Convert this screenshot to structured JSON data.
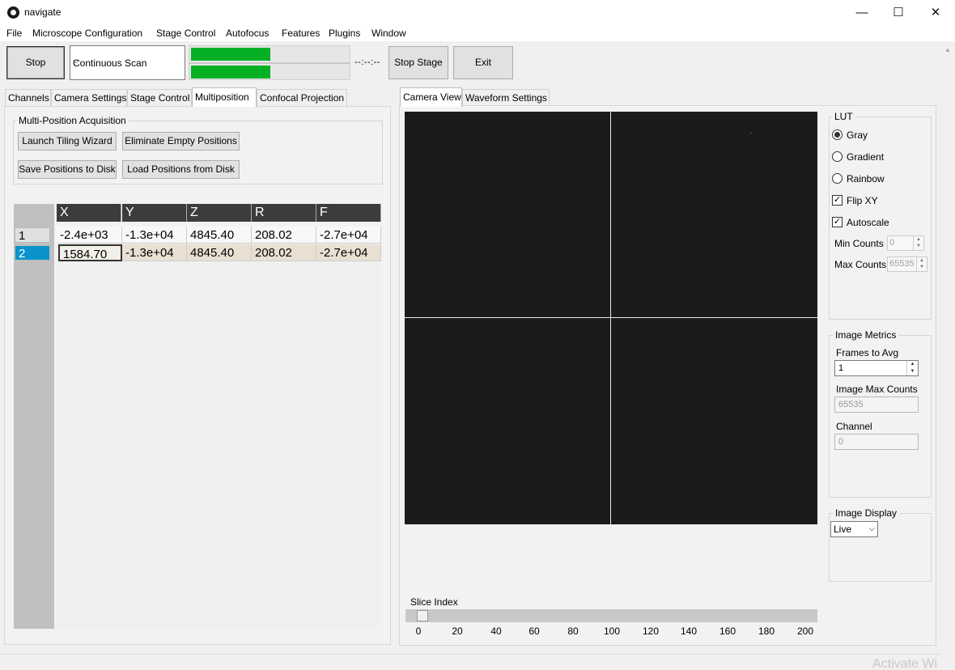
{
  "window": {
    "title": "navigate",
    "minimize_glyph": "—",
    "maximize_glyph": "☐",
    "close_glyph": "✕"
  },
  "menu": [
    "File",
    "Microscope Configuration",
    "Stage Control",
    "Autofocus",
    "Features",
    "Plugins",
    "Window"
  ],
  "toolbar": {
    "stop_label": "Stop",
    "mode_value": "Continuous Scan",
    "progress_top_fraction": 0.5,
    "progress_bottom_fraction": 0.5,
    "time_remaining": "--:--:--",
    "stop_stage_label": "Stop Stage",
    "exit_label": "Exit"
  },
  "left_tabs": [
    "Channels",
    "Camera Settings",
    "Stage Control",
    "Multiposition",
    "Confocal Projection"
  ],
  "left_active_tab": "Multiposition",
  "multiposition": {
    "group_title": "Multi-Position Acquisition",
    "launch_tiling": "Launch Tiling Wizard",
    "eliminate_empty": "Eliminate Empty Positions",
    "save_positions": "Save Positions to Disk",
    "load_positions": "Load Positions from Disk",
    "columns": [
      "X",
      "Y",
      "Z",
      "R",
      "F"
    ],
    "rows": [
      {
        "index": "1",
        "values": [
          "-2.4e+03",
          "-1.3e+04",
          "4845.40",
          "208.02",
          "-2.7e+04"
        ]
      },
      {
        "index": "2",
        "values": [
          "1584.70",
          "-1.3e+04",
          "4845.40",
          "208.02",
          "-2.7e+04"
        ]
      }
    ]
  },
  "right_tabs": [
    "Camera View",
    "Waveform Settings"
  ],
  "right_active_tab": "Camera View",
  "lut": {
    "title": "LUT",
    "gray": "Gray",
    "gradient": "Gradient",
    "rainbow": "Rainbow",
    "flip_xy": "Flip XY",
    "autoscale": "Autoscale",
    "min_counts_label": "Min Counts",
    "min_counts_value": "0",
    "max_counts_label": "Max Counts",
    "max_counts_value": "65535",
    "selected": "Gray",
    "flip_xy_checked": true,
    "autoscale_checked": true
  },
  "image_metrics": {
    "title": "Image Metrics",
    "frames_label": "Frames to Avg",
    "frames_value": "1",
    "max_counts_label": "Image Max Counts",
    "max_counts_value": "65535",
    "channel_label": "Channel",
    "channel_value": "0"
  },
  "image_display": {
    "title": "Image Display",
    "mode_value": "Live"
  },
  "slice": {
    "label": "Slice Index",
    "value": 0,
    "max": 200,
    "ticks": [
      "0",
      "20",
      "40",
      "60",
      "80",
      "100",
      "120",
      "140",
      "160",
      "180",
      "200"
    ]
  },
  "watermark": "Activate Wi"
}
